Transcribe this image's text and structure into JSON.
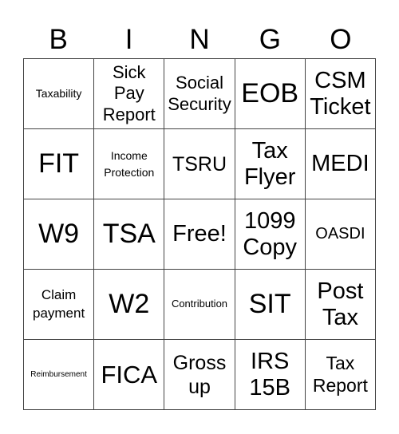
{
  "header": [
    "B",
    "I",
    "N",
    "G",
    "O"
  ],
  "cells": [
    [
      "Taxability",
      "Sick Pay Report",
      "Social Security",
      "EOB",
      "CSM Ticket"
    ],
    [
      "FIT",
      "Income Protection",
      "TSRU",
      "Tax Flyer",
      "MEDI"
    ],
    [
      "W9",
      "TSA",
      "Free!",
      "1099 Copy",
      "OASDI"
    ],
    [
      "Claim payment",
      "W2",
      "Contribution",
      "SIT",
      "Post Tax"
    ],
    [
      "Reimbursement",
      "FICA",
      "Gross up",
      "IRS 15B",
      "Tax Report"
    ]
  ]
}
